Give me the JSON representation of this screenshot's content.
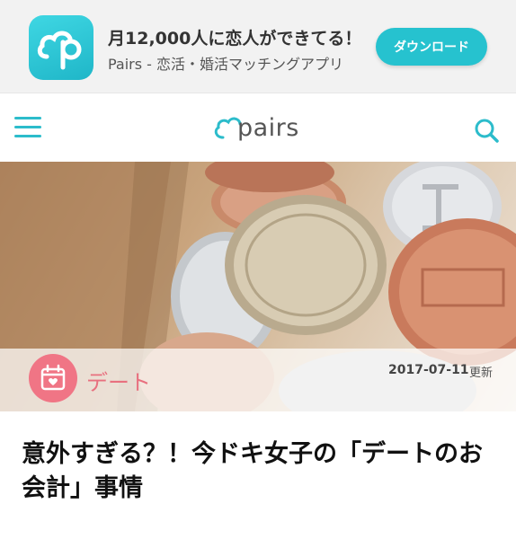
{
  "banner": {
    "tagline": "月12,000人に恋人ができてる！",
    "app_name": "Pairs - 恋活・婚活マッチングアプリ",
    "download_label": "ダウンロード",
    "icon": "pairs-app-icon"
  },
  "header": {
    "logo_text": "pairs",
    "menu_icon": "hamburger-menu-icon",
    "search_icon": "search-icon"
  },
  "article": {
    "category": "デート",
    "category_icon": "calendar-heart-icon",
    "date": "2017-07-11",
    "updated_label": "更新",
    "title": "意外すぎる？！今ドキ女子の「デートのお会計」事情",
    "hero_image": "coins-on-wooden-tray"
  },
  "colors": {
    "accent": "#26c2cf",
    "category": "#f07585",
    "banner_bg": "#f2f2f2"
  }
}
